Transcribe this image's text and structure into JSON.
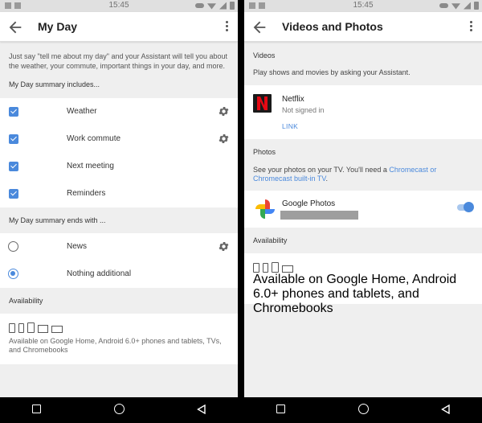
{
  "status_time": "15:45",
  "left": {
    "title": "My Day",
    "intro": "Just say \"tell me about my day\" and your Assistant will tell you about the weather, your commute, important things in your day, and more.",
    "includes_heading": "My Day summary includes...",
    "includes": [
      {
        "label": "Weather",
        "checked": true,
        "has_settings": true
      },
      {
        "label": "Work commute",
        "checked": true,
        "has_settings": true
      },
      {
        "label": "Next meeting",
        "checked": true,
        "has_settings": false
      },
      {
        "label": "Reminders",
        "checked": true,
        "has_settings": false
      }
    ],
    "ends_heading": "My Day summary ends with ...",
    "ends": [
      {
        "label": "News",
        "selected": false,
        "has_settings": true
      },
      {
        "label": "Nothing additional",
        "selected": true,
        "has_settings": false
      }
    ],
    "availability_heading": "Availability",
    "availability_text": "Available on Google Home, Android 6.0+ phones and tablets, TVs, and Chromebooks"
  },
  "right": {
    "title": "Videos and Photos",
    "videos_heading": "Videos",
    "videos_desc": "Play shows and movies by asking your Assistant.",
    "netflix": {
      "name": "Netflix",
      "status": "Not signed in",
      "link": "LINK"
    },
    "photos_heading": "Photos",
    "photos_desc_prefix": "See your photos on your TV. You'll need a ",
    "photos_desc_link": "Chromecast or Chromecast built-in TV",
    "photos_desc_suffix": ".",
    "google_photos": {
      "name": "Google Photos",
      "enabled": true
    },
    "availability_heading": "Availability",
    "availability_text": "Available on Google Home, Android 6.0+ phones and tablets, and Chromebooks"
  },
  "colors": {
    "accent": "#4a89dc",
    "netflix_red": "#e50914"
  },
  "icons": [
    "back-arrow-icon",
    "more-vert-icon",
    "gear-icon",
    "speaker-icon",
    "phone-icon",
    "tablet-icon",
    "tv-icon",
    "laptop-icon",
    "google-photos-icon",
    "netflix-icon"
  ]
}
